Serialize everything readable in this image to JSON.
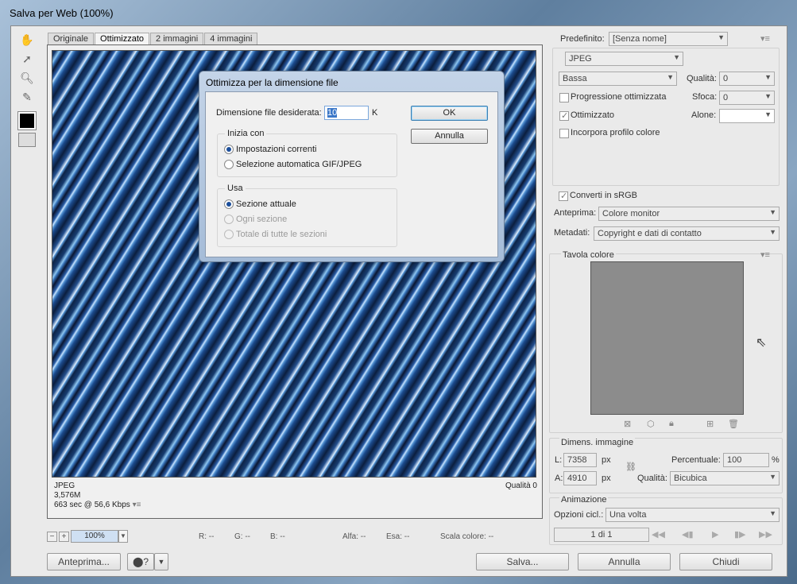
{
  "window": {
    "title": "Salva per Web (100%)"
  },
  "tabs": [
    "Originale",
    "Ottimizzato",
    "2 immagini",
    "4 immagini"
  ],
  "image_info": {
    "format": "JPEG",
    "size": "3,576M",
    "time": "663 sec @ 56,6 Kbps",
    "quality": "Qualità 0"
  },
  "statusbar": {
    "zoom": "100%",
    "r": "R: --",
    "g": "G: --",
    "b": "B: --",
    "alfa": "Alfa: --",
    "esa": "Esa: --",
    "scala": "Scala colore: --"
  },
  "bottom_buttons": {
    "preview": "Anteprima...",
    "save": "Salva...",
    "cancel": "Annulla",
    "close": "Chiudi"
  },
  "right_panel": {
    "preset_label": "Predefinito:",
    "preset_value": "[Senza nome]",
    "format": "JPEG",
    "quality_preset": "Bassa",
    "quality_label": "Qualità:",
    "quality_value": "0",
    "progressive": "Progressione ottimizzata",
    "blur_label": "Sfoca:",
    "blur_value": "0",
    "optimized": "Ottimizzato",
    "matte_label": "Alone:",
    "embed_profile": "Incorpora profilo colore",
    "convert_srgb": "Converti in sRGB",
    "preview_label": "Anteprima:",
    "preview_value": "Colore monitor",
    "metadata_label": "Metadati:",
    "metadata_value": "Copyright e dati di contatto",
    "color_table": "Tavola colore",
    "image_size": "Dimens. immagine",
    "w_label": "L:",
    "w_value": "7358",
    "w_unit": "px",
    "h_label": "A:",
    "h_value": "4910",
    "h_unit": "px",
    "percent_label": "Percentuale:",
    "percent_value": "100",
    "percent_unit": "%",
    "resample_label": "Qualità:",
    "resample_value": "Bicubica",
    "animation": "Animazione",
    "loop_label": "Opzioni cicl.:",
    "loop_value": "Una volta",
    "frame_counter": "1 di 1"
  },
  "dialog": {
    "title": "Ottimizza per la dimensione file",
    "size_label": "Dimensione file desiderata:",
    "size_value": "10",
    "size_unit": "K",
    "ok": "OK",
    "cancel": "Annulla",
    "start_group": "Inizia con",
    "start_opt1": "Impostazioni correnti",
    "start_opt2": "Selezione automatica GIF/JPEG",
    "use_group": "Usa",
    "use_opt1": "Sezione attuale",
    "use_opt2": "Ogni sezione",
    "use_opt3": "Totale di tutte le sezioni"
  }
}
